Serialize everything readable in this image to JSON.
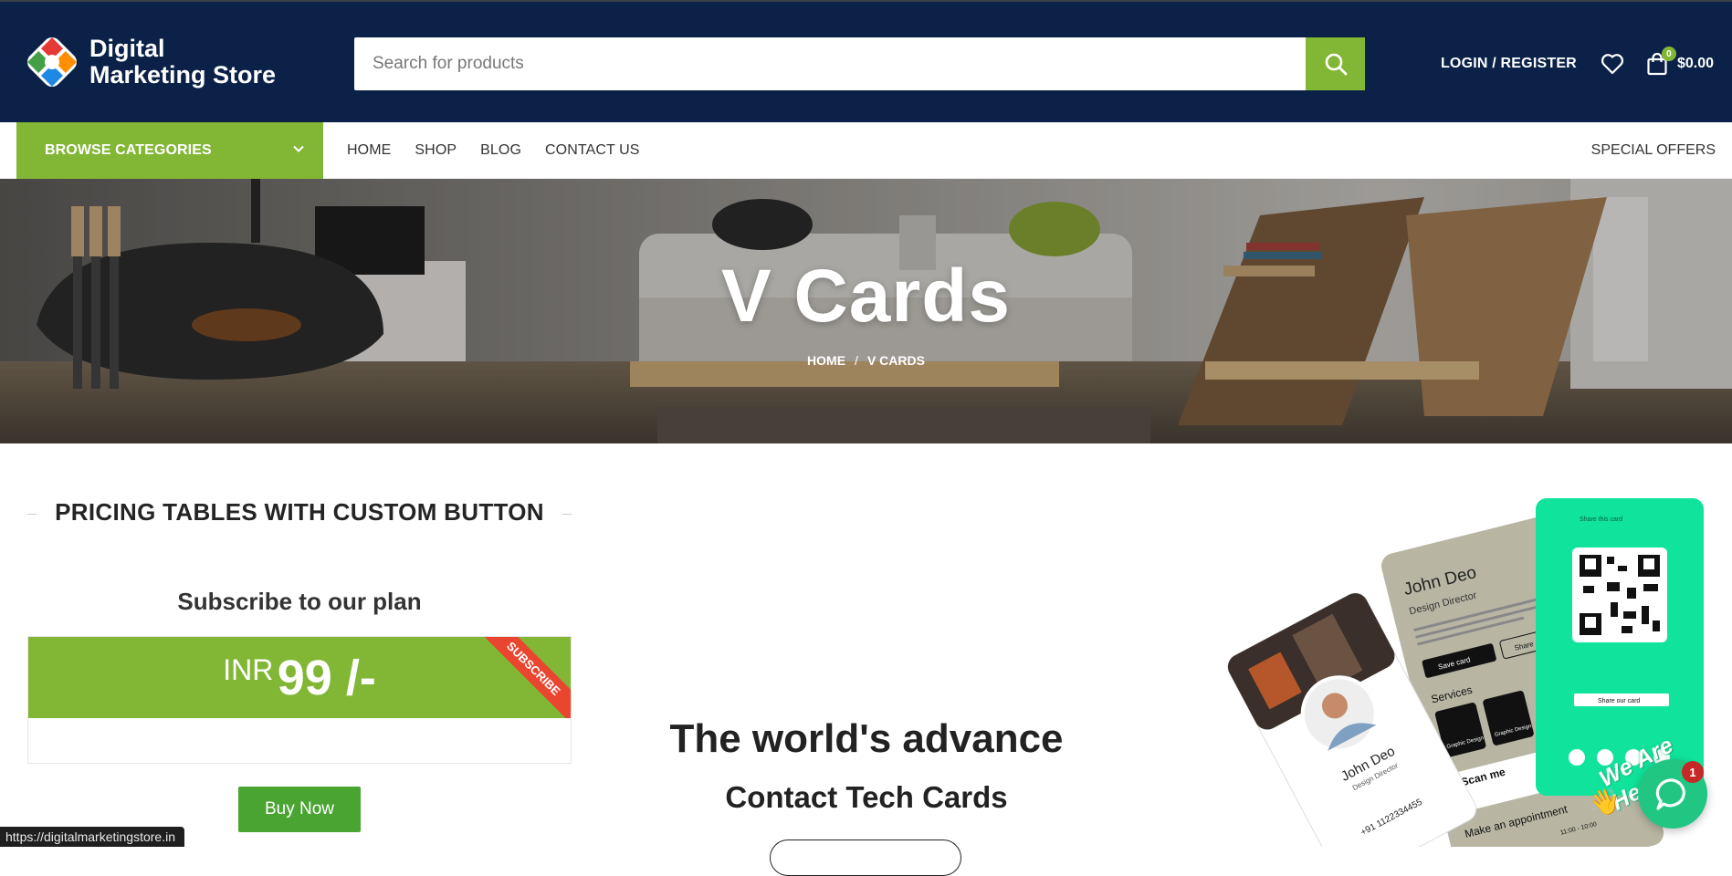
{
  "header": {
    "logo_line1": "Digital",
    "logo_line2": "Marketing Store",
    "search_placeholder": "Search for products",
    "login_label": "LOGIN / REGISTER",
    "cart_count": "0",
    "cart_total": "$0.00"
  },
  "nav": {
    "browse_label": "BROWSE CATEGORIES",
    "items": [
      "HOME",
      "SHOP",
      "BLOG",
      "CONTACT US"
    ],
    "special_label": "SPECIAL OFFERS"
  },
  "hero": {
    "title": "V Cards",
    "breadcrumb_home": "HOME",
    "breadcrumb_sep": "/",
    "breadcrumb_current": "V CARDS"
  },
  "pricing": {
    "section_title": "PRICING TABLES WITH CUSTOM BUTTON",
    "plan_heading": "Subscribe to our plan",
    "currency": "INR",
    "amount": "99 /-",
    "ribbon": "SUBSCRIBE",
    "button_label": "Buy Now"
  },
  "promo": {
    "headline": "The world's advance",
    "subheadline": "Contact Tech Cards"
  },
  "cards_graphic": {
    "front_name": "John Deo",
    "front_role": "Design Director",
    "front_phone": "+91 1122334455",
    "back_name": "John Deo",
    "back_role": "Design Director",
    "save_card": "Save card",
    "share_card": "Share card",
    "services": "Services",
    "service_1": "Graphic Design",
    "service_2": "Graphic Design",
    "scan_me": "Scan me",
    "appointment": "Make an appointment",
    "time": "11:00 - 10:00",
    "share_this_card": "Share this card",
    "share_our_card": "Share our card"
  },
  "chat": {
    "badge": "1",
    "tagline": "We Are Here!"
  },
  "status_url": "https://digitalmarketingstore.in",
  "colors": {
    "header_bg": "#0b2147",
    "accent_green": "#82b735",
    "buy_green": "#4aa432",
    "ribbon_red": "#e9452f",
    "chat_green": "#21c683"
  }
}
